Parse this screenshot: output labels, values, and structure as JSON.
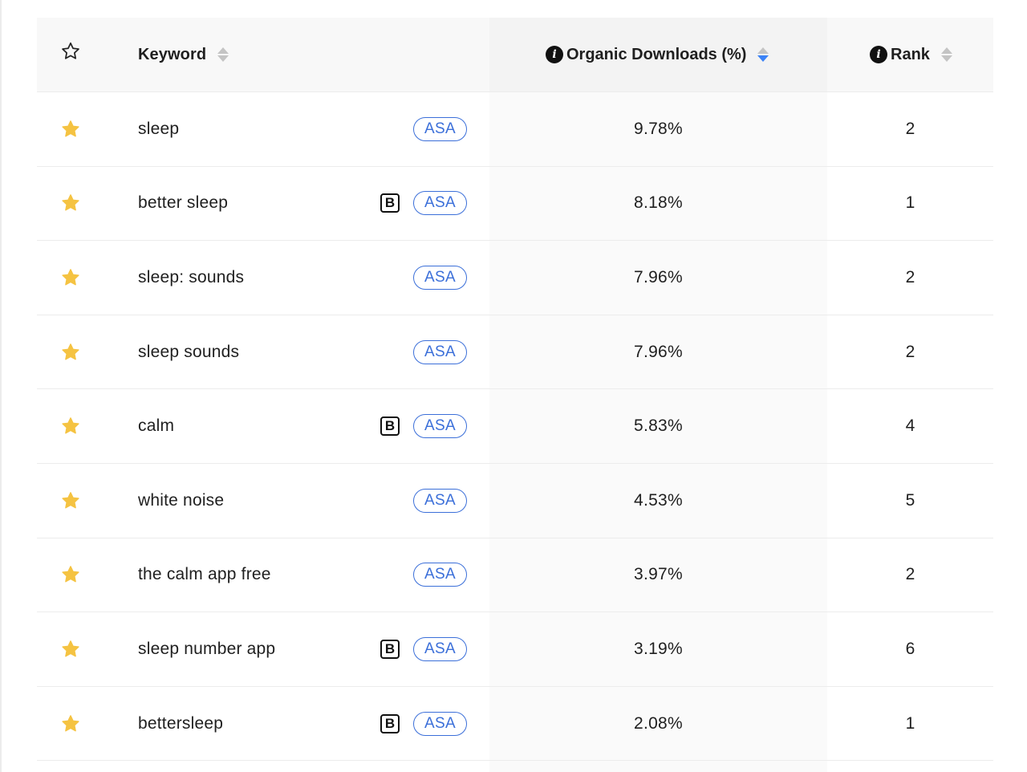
{
  "colors": {
    "star_fill": "#f5c342",
    "asa_blue": "#3b6fd9",
    "sort_active": "#3b82f6"
  },
  "header": {
    "favorite_icon": "star-outline-icon",
    "keyword_label": "Keyword",
    "organic_label": "Organic Downloads (%)",
    "rank_label": "Rank",
    "info_glyph": "i",
    "sorted_column": "Organic Downloads (%)",
    "sort_direction": "descending"
  },
  "badges": {
    "brand_label": "B",
    "asa_label": "ASA"
  },
  "rows": [
    {
      "keyword": "sleep",
      "brand": false,
      "asa": true,
      "organic": "9.78%",
      "rank": "2",
      "favorite": true
    },
    {
      "keyword": "better sleep",
      "brand": true,
      "asa": true,
      "organic": "8.18%",
      "rank": "1",
      "favorite": true
    },
    {
      "keyword": "sleep: sounds",
      "brand": false,
      "asa": true,
      "organic": "7.96%",
      "rank": "2",
      "favorite": true
    },
    {
      "keyword": "sleep sounds",
      "brand": false,
      "asa": true,
      "organic": "7.96%",
      "rank": "2",
      "favorite": true
    },
    {
      "keyword": "calm",
      "brand": true,
      "asa": true,
      "organic": "5.83%",
      "rank": "4",
      "favorite": true
    },
    {
      "keyword": "white noise",
      "brand": false,
      "asa": true,
      "organic": "4.53%",
      "rank": "5",
      "favorite": true
    },
    {
      "keyword": "the calm app free",
      "brand": false,
      "asa": true,
      "organic": "3.97%",
      "rank": "2",
      "favorite": true
    },
    {
      "keyword": "sleep number app",
      "brand": true,
      "asa": true,
      "organic": "3.19%",
      "rank": "6",
      "favorite": true
    },
    {
      "keyword": "bettersleep",
      "brand": true,
      "asa": true,
      "organic": "2.08%",
      "rank": "1",
      "favorite": true
    }
  ]
}
